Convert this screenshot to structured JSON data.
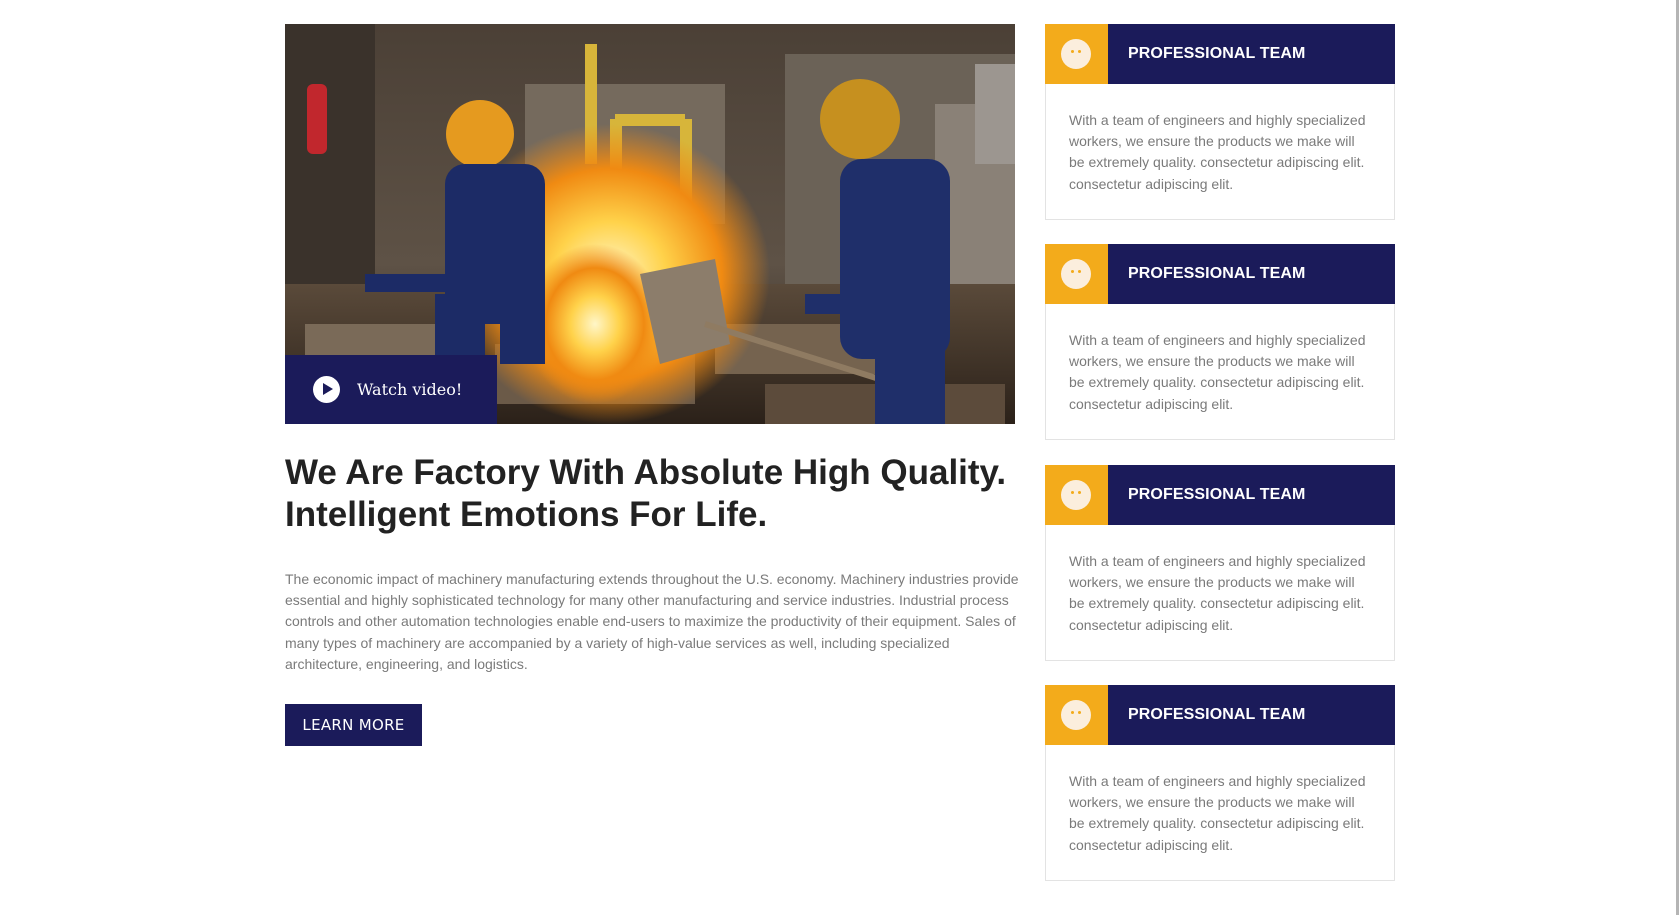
{
  "hero": {
    "image_alt": "Workers pouring molten metal in a foundry",
    "watch_video_label": "Watch video!",
    "play_icon": "play-circle-icon"
  },
  "headline": {
    "line1": "We Are Factory With Absolute High Quality.",
    "line2": "Intelligent Emotions For Life."
  },
  "body_text": "The economic impact of machinery manufacturing extends throughout the U.S. economy. Machinery industries provide essential and highly sophisticated technology for many other manufacturing and service industries. Industrial process controls and other automation technologies enable end-users to maximize the productivity of their equipment. Sales of many types of machinery are accompanied by a variety of high-value services as well, including specialized architecture, engineering, and logistics.",
  "learn_more_label": "LEARN MORE",
  "cards": [
    {
      "title": "PROFESSIONAL TEAM",
      "text": "With a team of engineers and highly specialized workers, we ensure the products we make will be extremely quality. consectetur adipiscing elit. consectetur adipiscing elit.",
      "icon": "smiley-face-icon"
    },
    {
      "title": "PROFESSIONAL TEAM",
      "text": "With a team of engineers and highly specialized workers, we ensure the products we make will be extremely quality. consectetur adipiscing elit. consectetur adipiscing elit.",
      "icon": "smiley-face-icon"
    },
    {
      "title": "PROFESSIONAL TEAM",
      "text": "With a team of engineers and highly specialized workers, we ensure the products we make will be extremely quality. consectetur adipiscing elit. consectetur adipiscing elit.",
      "icon": "smiley-face-icon"
    },
    {
      "title": "PROFESSIONAL TEAM",
      "text": "With a team of engineers and highly specialized workers, we ensure the products we make will be extremely quality. consectetur adipiscing elit. consectetur adipiscing elit.",
      "icon": "smiley-face-icon"
    }
  ],
  "colors": {
    "navy": "#1b1b5a",
    "accent_orange": "#f3ab1b",
    "heading": "#222222",
    "body_text": "#7a7a7a"
  }
}
